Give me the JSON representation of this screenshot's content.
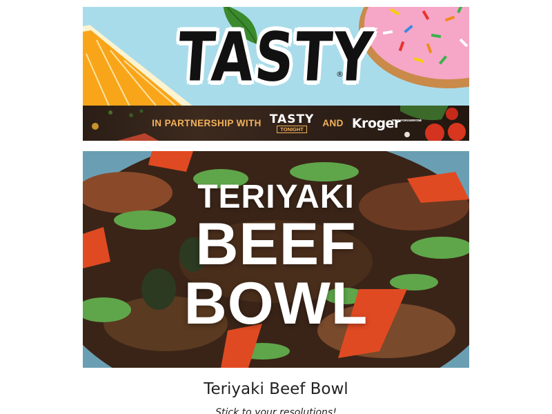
{
  "header": {
    "logo_text": "TASTY",
    "registered_mark": "®"
  },
  "partnership": {
    "prefix": "IN PARTNERSHIP WITH",
    "partner1_word": "TASTY",
    "partner1_sub": "TONIGHT",
    "joiner": "AND",
    "partner2": "Kroger",
    "partner2_tag": "FRESH FOR EVERYONE"
  },
  "recipe_image": {
    "title_line1": "TERIYAKI",
    "title_line2": "BEEF",
    "title_line3": "BOWL"
  },
  "recipe": {
    "title": "Teriyaki Beef Bowl",
    "subtitle": "Stick to your resolutions!"
  },
  "colors": {
    "sky_blue": "#a9dcea",
    "strip_brown": "#2f2119",
    "strip_orange": "#f3b25b",
    "bowl_teal": "#6a9fb3"
  }
}
